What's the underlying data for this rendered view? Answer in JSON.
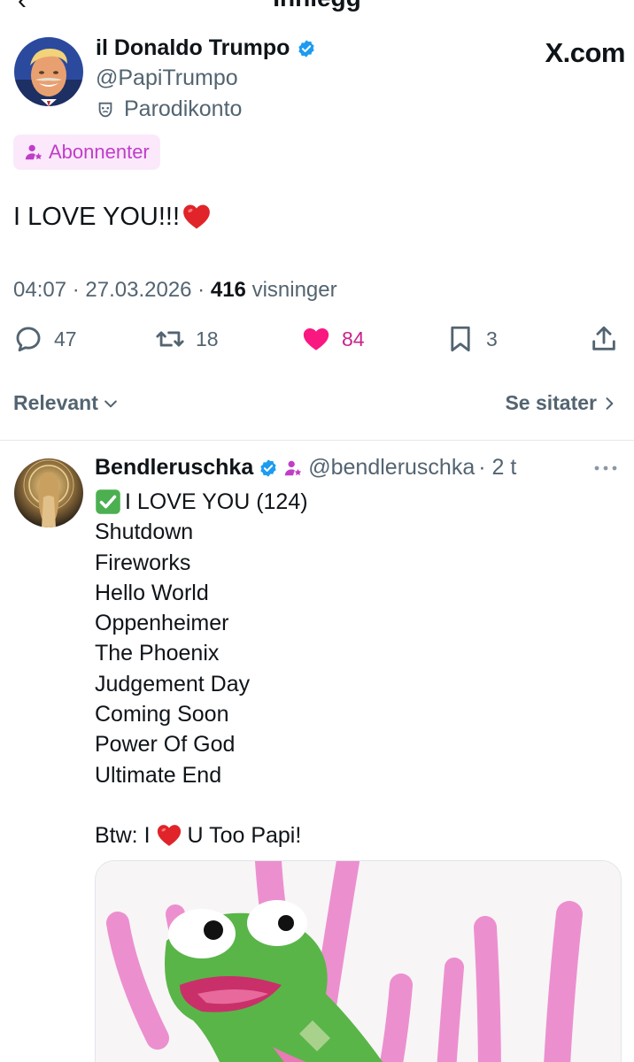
{
  "header": {
    "title": "Innlegg",
    "back_icon": "back-arrow-icon"
  },
  "post": {
    "display_name": "il Donaldo Trumpo",
    "handle": "@PapiTrumpo",
    "parody_label": "Parodikonto",
    "brand": "X.com",
    "subscribe_label": "Abonnenter",
    "text": "I LOVE YOU!!!",
    "time": "04:07",
    "date": "27.03.2026",
    "views_count": "416",
    "views_label": "visninger",
    "stats": {
      "replies": "47",
      "reposts": "18",
      "likes": "84",
      "bookmarks": "3"
    },
    "colors": {
      "verified": "#1d9bf0",
      "like": "#f91880",
      "subscribe": "#c03dc9"
    }
  },
  "sort": {
    "left_label": "Relevant",
    "right_label": "Se sitater"
  },
  "reply": {
    "display_name": "Bendleruschka",
    "handle": "@bendleruschka",
    "time": "· 2 t",
    "first_line": "I LOVE YOU (124)",
    "lines": [
      "Shutdown",
      "Fireworks",
      "Hello World",
      "Oppenheimer",
      "The Phoenix",
      "Judgement Day",
      "Coming Soon",
      "Power Of God",
      "Ultimate End"
    ],
    "closing_prefix": "Btw: I",
    "closing_suffix": "U Too Papi!"
  }
}
